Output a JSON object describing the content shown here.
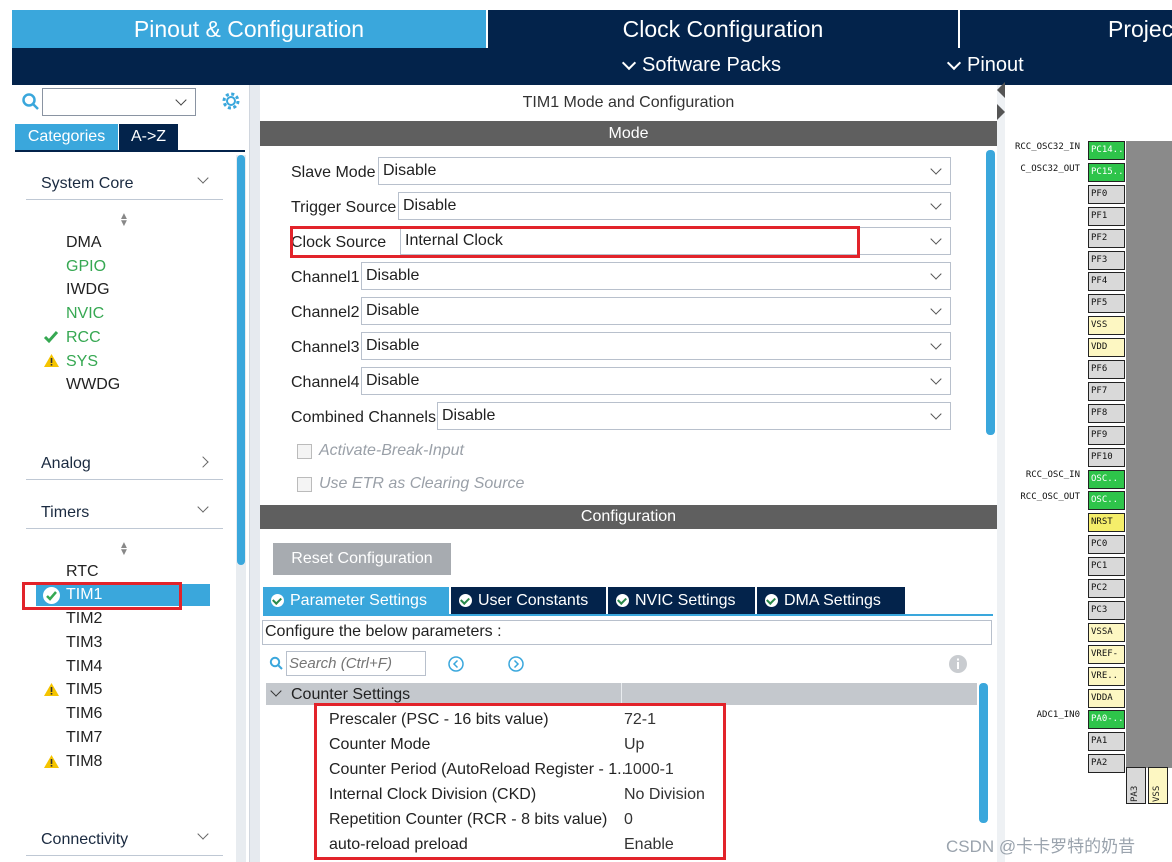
{
  "top_tabs": [
    "Pinout & Configuration",
    "Clock Configuration",
    "Projec"
  ],
  "subnav": [
    "Software Packs",
    "Pinout"
  ],
  "left": {
    "tabs": [
      "Categories",
      "A->Z"
    ],
    "categories": {
      "system_core": "System Core",
      "analog": "Analog",
      "timers": "Timers",
      "connectivity": "Connectivity"
    },
    "system_core_items": [
      "DMA",
      "GPIO",
      "IWDG",
      "NVIC",
      "RCC",
      "SYS",
      "WWDG"
    ],
    "timer_items": [
      "RTC",
      "TIM1",
      "TIM2",
      "TIM3",
      "TIM4",
      "TIM5",
      "TIM6",
      "TIM7",
      "TIM8"
    ]
  },
  "mode": {
    "title": "TIM1 Mode and Configuration",
    "section": "Mode",
    "fields": [
      {
        "label": "Slave Mode",
        "value": "Disable"
      },
      {
        "label": "Trigger Source",
        "value": "Disable"
      },
      {
        "label": "Clock Source",
        "value": "Internal Clock"
      },
      {
        "label": "Channel1",
        "value": "Disable"
      },
      {
        "label": "Channel2",
        "value": "Disable"
      },
      {
        "label": "Channel3",
        "value": "Disable"
      },
      {
        "label": "Channel4",
        "value": "Disable"
      },
      {
        "label": "Combined Channels",
        "value": "Disable"
      }
    ],
    "checkboxes": [
      "Activate-Break-Input",
      "Use ETR as Clearing Source"
    ]
  },
  "config": {
    "section": "Configuration",
    "reset_label": "Reset Configuration",
    "tabs": [
      "Parameter Settings",
      "User Constants",
      "NVIC Settings",
      "DMA Settings"
    ],
    "hint": "Configure the below parameters :",
    "search_placeholder": "Search (Ctrl+F)",
    "group": "Counter Settings",
    "params": [
      {
        "name": "Prescaler (PSC - 16 bits value)",
        "value": "72-1"
      },
      {
        "name": "Counter Mode",
        "value": "Up"
      },
      {
        "name": "Counter Period (AutoReload Register - 1...",
        "value": "1000-1"
      },
      {
        "name": "Internal Clock Division (CKD)",
        "value": "No Division"
      },
      {
        "name": "Repetition Counter (RCR - 8 bits value)",
        "value": "0"
      },
      {
        "name": "auto-reload preload",
        "value": "Enable"
      }
    ]
  },
  "pins": {
    "labels": [
      "RCC_OSC32_IN",
      "C_OSC32_OUT",
      "RCC_OSC_IN",
      "RCC_OSC_OUT",
      "ADC1_IN0"
    ],
    "names": [
      "PC14..",
      "PC15..",
      "PF0",
      "PF1",
      "PF2",
      "PF3",
      "PF4",
      "PF5",
      "VSS",
      "VDD",
      "PF6",
      "PF7",
      "PF8",
      "PF9",
      "PF10",
      "OSC..",
      "OSC..",
      "NRST",
      "PC0",
      "PC1",
      "PC2",
      "PC3",
      "VSSA",
      "VREF-",
      "VRE..",
      "VDDA",
      "PA0-..",
      "PA1",
      "PA2"
    ],
    "bottom": [
      "PA3",
      "VSS"
    ]
  },
  "watermark": "CSDN @卡卡罗特的奶昔"
}
